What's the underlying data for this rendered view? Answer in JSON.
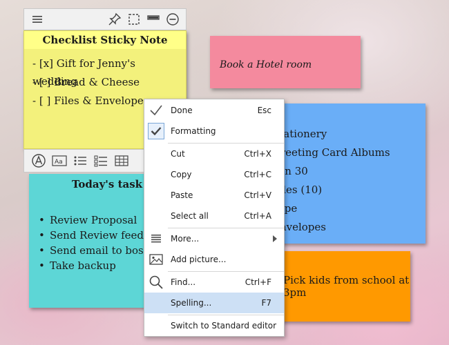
{
  "checklist_note": {
    "title": "Checklist Sticky Note",
    "items": [
      "- [x] Gift for Jenny's wedding",
      "- [ ]  Bread & Cheese",
      "- [ ] Files & Envelopes"
    ]
  },
  "task_note": {
    "title": "Today's task list",
    "items": [
      "Review Proposal",
      "Send Review feedback",
      "Send email to boss",
      "Take backup"
    ]
  },
  "hotel_note": {
    "text": "Book a Hotel room"
  },
  "blue_note": {
    "lines": [
      "Stationery",
      "Greeting Card Albums",
      "Pen 30",
      "Files (10)",
      "Tape",
      "Envelopes"
    ]
  },
  "orange_note": {
    "text": "Pick kids from school at 3pm"
  },
  "context_menu": {
    "done": {
      "label": "Done",
      "shortcut": "Esc"
    },
    "formatting": {
      "label": "Formatting",
      "shortcut": ""
    },
    "cut": {
      "label": "Cut",
      "shortcut": "Ctrl+X"
    },
    "copy": {
      "label": "Copy",
      "shortcut": "Ctrl+C"
    },
    "paste": {
      "label": "Paste",
      "shortcut": "Ctrl+V"
    },
    "select_all": {
      "label": "Select all",
      "shortcut": "Ctrl+A"
    },
    "more": {
      "label": "More..."
    },
    "add_picture": {
      "label": "Add picture..."
    },
    "find": {
      "label": "Find...",
      "shortcut": "Ctrl+F"
    },
    "spelling": {
      "label": "Spelling...",
      "shortcut": "F7"
    },
    "switch_editor": {
      "label": "Switch to Standard editor"
    }
  },
  "colors": {
    "checklist": "#f3f17c",
    "task": "#5dd6d6",
    "hotel": "#f48a9e",
    "blue": "#6aaef7",
    "orange": "#ff9900",
    "menu_highlight": "#cde0f5"
  }
}
